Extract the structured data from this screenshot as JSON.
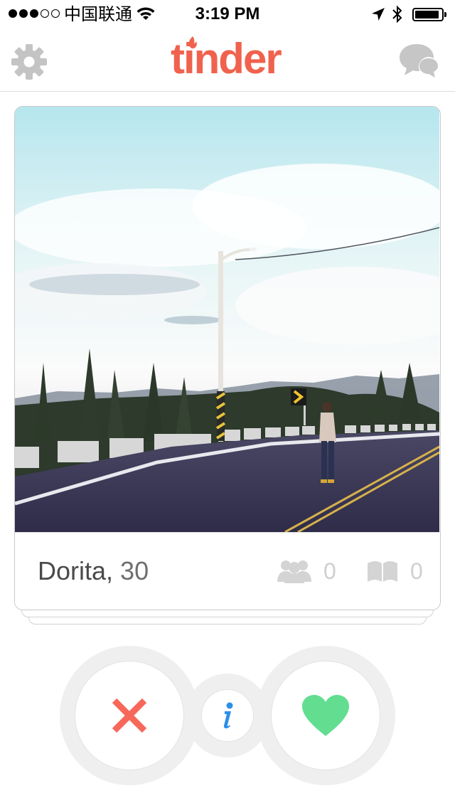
{
  "status_bar": {
    "signal_full": 3,
    "signal_total": 5,
    "carrier": "中国联通",
    "time": "3:19 PM",
    "battery_level": 0.8,
    "icons": [
      "signal-dots-icon",
      "wifi-icon",
      "location-arrow-icon",
      "bluetooth-icon",
      "battery-icon"
    ]
  },
  "nav": {
    "brand": "tinder",
    "brand_color": "#f0624d",
    "left_icon": "gear-icon",
    "right_icon": "chat-bubbles-icon"
  },
  "card": {
    "name": "Dorita,",
    "age": "30",
    "photo": "road-with-lamppost-and-woman-walking",
    "shared_friends_count": "0",
    "shared_interests_count": "0",
    "icons": [
      "friends-icon",
      "book-icon"
    ]
  },
  "actions": {
    "dislike_icon": "x-icon",
    "dislike_color": "#f7685a",
    "info_icon": "info-icon",
    "info_color": "#2b8fea",
    "like_icon": "heart-icon",
    "like_color": "#63de91"
  }
}
